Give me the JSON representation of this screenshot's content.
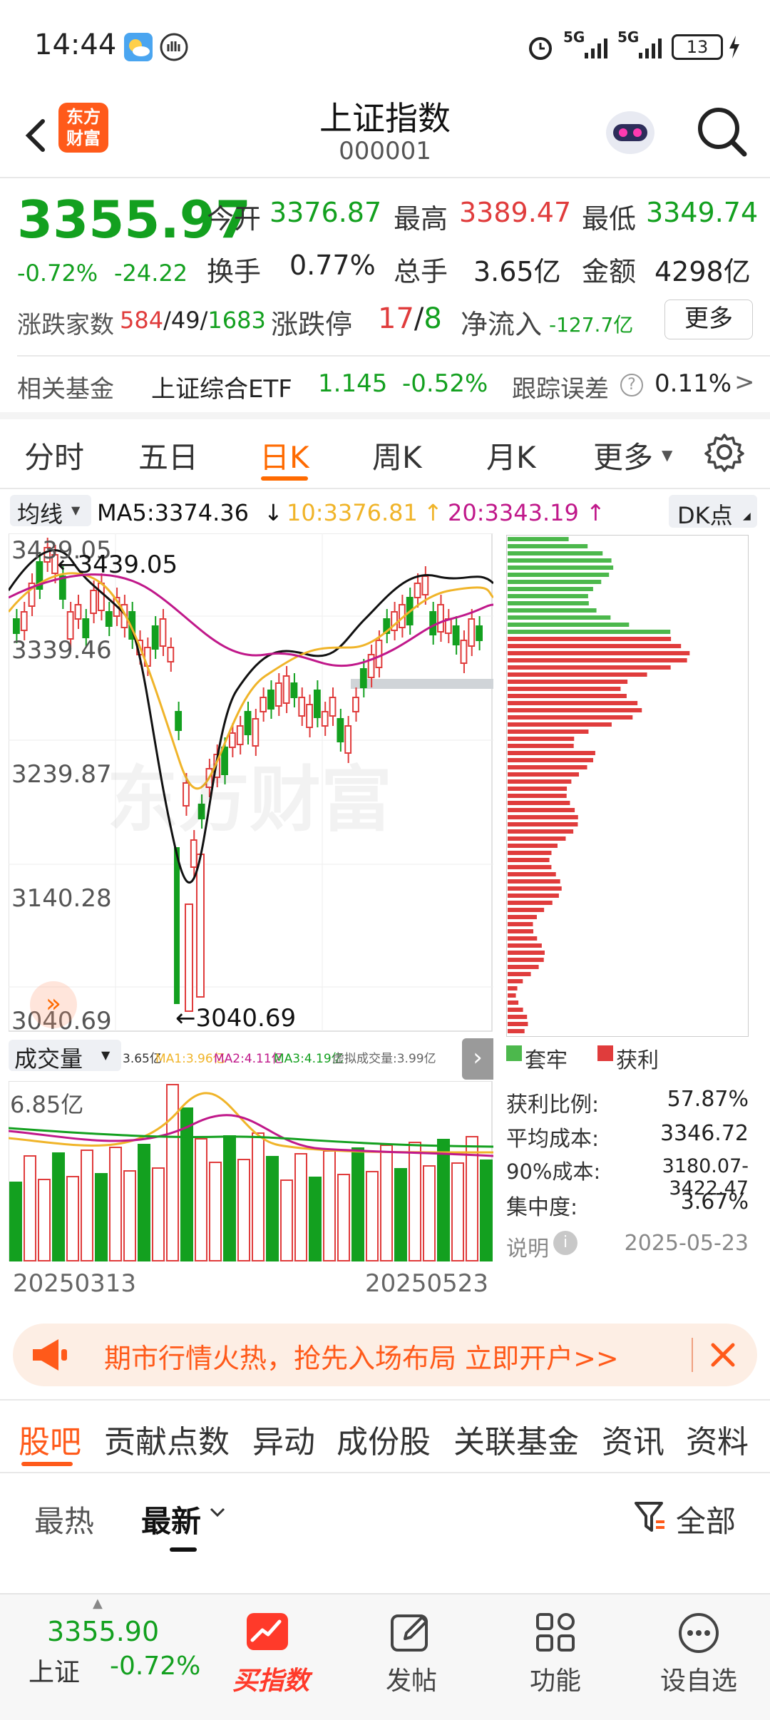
{
  "status_bar": {
    "time": "14:44",
    "signal1": "5G",
    "signal2": "5G",
    "battery": "13"
  },
  "header": {
    "title": "上证指数",
    "code": "000001",
    "logo_line1": "东方",
    "logo_line2": "财富"
  },
  "quote": {
    "price": "3355.97",
    "change_pct": "-0.72%",
    "change": "-24.22",
    "open_label": "今开",
    "open": "3376.87",
    "high_label": "最高",
    "high": "3389.47",
    "low_label": "最低",
    "low": "3349.74",
    "turnover_label": "换手",
    "turnover": "0.77%",
    "volume_label": "总手",
    "volume": "3.65亿",
    "amount_label": "金额",
    "amount": "4298亿",
    "breadth_label": "涨跌家数",
    "up": "584",
    "flat": "49",
    "down": "1683",
    "limit_label": "涨跌停",
    "limit_up": "17",
    "limit_down": "8",
    "netflow_label": "净流入",
    "netflow": "-127.7亿",
    "more_button": "更多"
  },
  "fund_row": {
    "label": "相关基金",
    "name": "上证综合ETF",
    "price": "1.145",
    "pct": "-0.52%",
    "err_label": "跟踪误差",
    "err": "0.11%",
    "arrow": ">"
  },
  "period_tabs": [
    {
      "label": "分时"
    },
    {
      "label": "五日"
    },
    {
      "label": "日K",
      "active": true
    },
    {
      "label": "周K"
    },
    {
      "label": "月K"
    },
    {
      "label": "更多"
    }
  ],
  "ma_bar": {
    "selector": "均线",
    "ma5": "MA5:3374.36",
    "ma10": "10:3376.81",
    "ma20": "20:3343.19",
    "dk": "DK点"
  },
  "kline": {
    "y_labels": [
      "3439.05",
      "3339.46",
      "3239.87",
      "3140.28",
      "3040.69"
    ],
    "high_marker": "←3439.05",
    "low_marker": "←3040.69",
    "watermark": "东方财富"
  },
  "volume_bar": {
    "selector": "成交量",
    "vol": "3.65亿",
    "ma1": "MA1:3.96亿",
    "ma2": "MA2:4.11亿",
    "ma3": "MA3:4.19亿",
    "virtual": "虚拟成交量:3.99亿",
    "max_label": "6.85亿"
  },
  "dates": {
    "start": "20250313",
    "end": "20250523"
  },
  "chip": {
    "legend_trapped": "套牢",
    "legend_profit": "获利",
    "profit_ratio_label": "获利比例:",
    "profit_ratio": "57.87%",
    "avg_cost_label": "平均成本:",
    "avg_cost": "3346.72",
    "cost90_label": "90%成本:",
    "cost90": "3180.07-3422.47",
    "concentration_label": "集中度:",
    "concentration": "3.67%",
    "note_label": "说明",
    "date": "2025-05-23"
  },
  "banner": {
    "text": "期市行情火热，抢先入场布局 立即开户>>"
  },
  "section_tabs": [
    {
      "label": "股吧",
      "active": true
    },
    {
      "label": "贡献点数"
    },
    {
      "label": "异动"
    },
    {
      "label": "成份股"
    },
    {
      "label": "关联基金"
    },
    {
      "label": "资讯"
    },
    {
      "label": "资料"
    }
  ],
  "sort": {
    "hot": "最热",
    "latest": "最新",
    "filter": "全部"
  },
  "bottom": {
    "price": "3355.90",
    "name": "上证",
    "pct": "-0.72%",
    "buy_index": "买指数",
    "post": "发帖",
    "functions": "功能",
    "watchlist": "设自选"
  },
  "colors": {
    "up": "#e03c3c",
    "down": "#13a01f",
    "ma5": "#111111",
    "ma10": "#f0b429",
    "ma20": "#c0188a",
    "accent": "#ff6a00"
  }
}
